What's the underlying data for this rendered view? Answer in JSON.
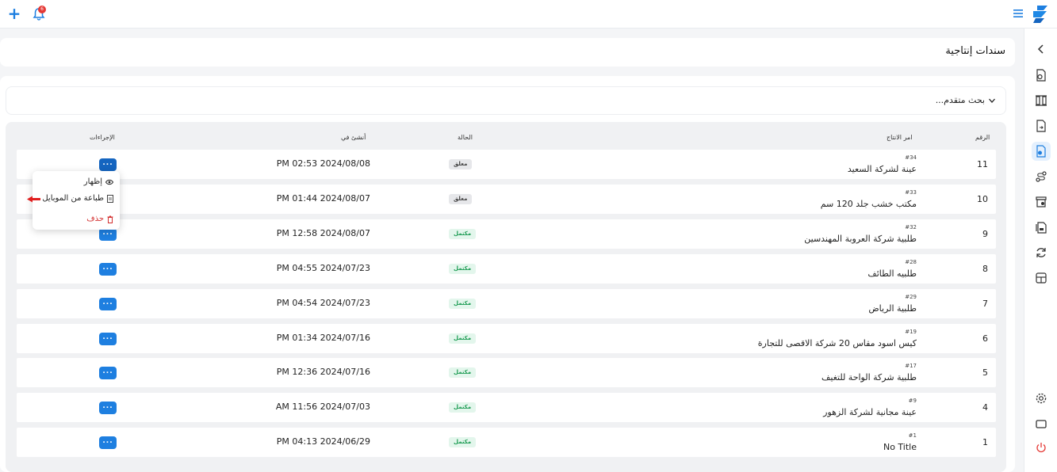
{
  "topbar": {
    "notification_count": "6"
  },
  "page": {
    "title": "سندات إنتاجية"
  },
  "search": {
    "label": "بحث متقدم..."
  },
  "table": {
    "headers": {
      "number": "الرقم",
      "order": "امر الانتاج",
      "status": "الحالة",
      "created": "أنشئ في",
      "actions": "الإجراءات"
    },
    "rows": [
      {
        "num": "11",
        "code": "#34",
        "name": "عينة لشركة السعيد",
        "status": "معلق",
        "status_type": "pending",
        "date": "PM 02:53 2024/08/08"
      },
      {
        "num": "10",
        "code": "#33",
        "name": "مكتب خشب جلد 120 سم",
        "status": "معلق",
        "status_type": "pending",
        "date": "PM 01:44 2024/08/07"
      },
      {
        "num": "9",
        "code": "#32",
        "name": "طلبية شركة العروبة المهندسين",
        "status": "مكتمل",
        "status_type": "done",
        "date": "PM 12:58 2024/08/07"
      },
      {
        "num": "8",
        "code": "#28",
        "name": "طلبيه الطائف",
        "status": "مكتمل",
        "status_type": "done",
        "date": "PM 04:55 2024/07/23"
      },
      {
        "num": "7",
        "code": "#29",
        "name": "طلبية الرياض",
        "status": "مكتمل",
        "status_type": "done",
        "date": "PM 04:54 2024/07/23"
      },
      {
        "num": "6",
        "code": "#19",
        "name": "كيس اسود مقاس 20 شركة الاقصى للتجارة",
        "status": "مكتمل",
        "status_type": "done",
        "date": "PM 01:34 2024/07/16"
      },
      {
        "num": "5",
        "code": "#17",
        "name": "طلبية شركة الواحة للتغيف",
        "status": "مكتمل",
        "status_type": "done",
        "date": "PM 12:36 2024/07/16"
      },
      {
        "num": "4",
        "code": "#9",
        "name": "عينة مجانية لشركة الزهور",
        "status": "مكتمل",
        "status_type": "done",
        "date": "AM 11:56 2024/07/03"
      },
      {
        "num": "1",
        "code": "#1",
        "name": "No Title",
        "status": "مكتمل",
        "status_type": "done",
        "date": "PM 04:13 2024/06/29"
      }
    ],
    "action_label": "..."
  },
  "action_menu": {
    "show": "إظهار",
    "print_mobile": "طباعة من الموبايل",
    "delete": "حذف"
  },
  "icons": {
    "top": [
      "plus-icon",
      "bell-icon",
      "hamburger-icon",
      "logo-icon"
    ],
    "sidebar": [
      "chevron-left-icon",
      "document-money-icon",
      "columns-icon",
      "document-export-icon",
      "document-production-icon",
      "route-icon",
      "inventory-icon",
      "documents-icon",
      "refresh-icon",
      "table-icon",
      "gear-icon",
      "window-icon",
      "power-icon"
    ]
  },
  "colors": {
    "accent": "#1e7fe0",
    "danger": "#d32f2f",
    "success": "#1f9d55"
  }
}
